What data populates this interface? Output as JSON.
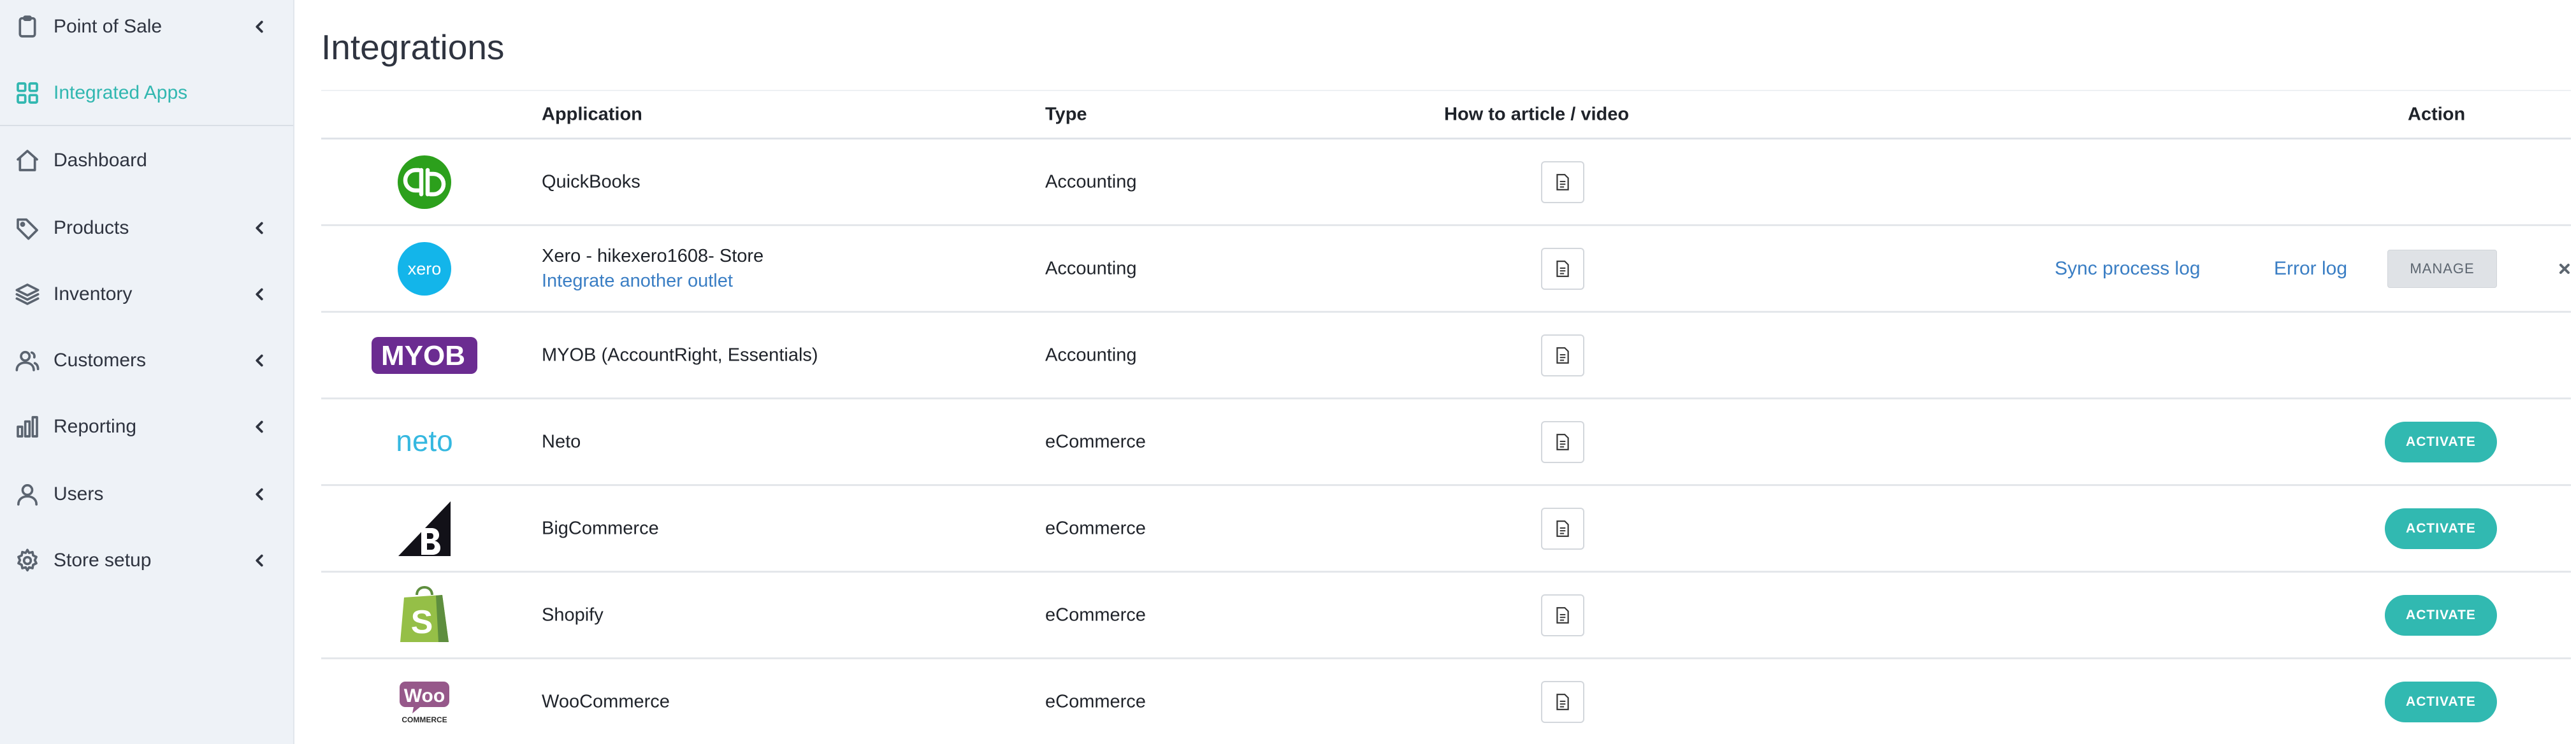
{
  "sidebar": {
    "items": [
      {
        "label": "Point of Sale",
        "icon": "clipboard-icon",
        "chevron": true,
        "active": false
      },
      {
        "label": "Integrated Apps",
        "icon": "grid-icon",
        "chevron": false,
        "active": true
      },
      {
        "label": "Dashboard",
        "icon": "home-icon",
        "chevron": false,
        "active": false
      },
      {
        "label": "Products",
        "icon": "tag-icon",
        "chevron": true,
        "active": false
      },
      {
        "label": "Inventory",
        "icon": "layers-icon",
        "chevron": true,
        "active": false
      },
      {
        "label": "Customers",
        "icon": "users-icon",
        "chevron": true,
        "active": false
      },
      {
        "label": "Reporting",
        "icon": "bar-chart-icon",
        "chevron": true,
        "active": false
      },
      {
        "label": "Users",
        "icon": "user-icon",
        "chevron": true,
        "active": false
      },
      {
        "label": "Store setup",
        "icon": "gear-icon",
        "chevron": true,
        "active": false
      }
    ],
    "accent_color": "#31b7b0"
  },
  "main": {
    "title": "Integrations",
    "columns": {
      "application": "Application",
      "type": "Type",
      "howto": "How to article / video",
      "action": "Action"
    },
    "rows": [
      {
        "logo": "quickbooks-logo",
        "name": "QuickBooks",
        "sublink": "",
        "type": "Accounting"
      },
      {
        "logo": "xero-logo",
        "name": "Xero - hikexero1608- Store",
        "sublink": "Integrate another outlet",
        "type": "Accounting",
        "actions": {
          "sync_log": "Sync process log",
          "error_log": "Error log",
          "manage": "MANAGE"
        }
      },
      {
        "logo": "myob-logo",
        "logo_text": "MYOB",
        "name": "MYOB (AccountRight, Essentials)",
        "sublink": "",
        "type": "Accounting"
      },
      {
        "logo": "neto-logo",
        "logo_text": "neto",
        "name": "Neto",
        "sublink": "",
        "type": "eCommerce",
        "activate": "ACTIVATE"
      },
      {
        "logo": "bigcommerce-logo",
        "name": "BigCommerce",
        "sublink": "",
        "type": "eCommerce",
        "activate": "ACTIVATE"
      },
      {
        "logo": "shopify-logo",
        "name": "Shopify",
        "sublink": "",
        "type": "eCommerce",
        "activate": "ACTIVATE"
      },
      {
        "logo": "woocommerce-logo",
        "logo_text": "Woo",
        "logo_subtext": "COMMERCE",
        "name": "WooCommerce",
        "sublink": "",
        "type": "eCommerce",
        "activate": "ACTIVATE"
      }
    ],
    "colors": {
      "activate": "#31b9b1",
      "link": "#3a7ec4",
      "quickbooks": "#2ca01c",
      "xero": "#13b5ea",
      "myob": "#6b2c91",
      "neto": "#35b8e0",
      "shopify": "#95bf47",
      "woocommerce": "#96588a"
    }
  }
}
